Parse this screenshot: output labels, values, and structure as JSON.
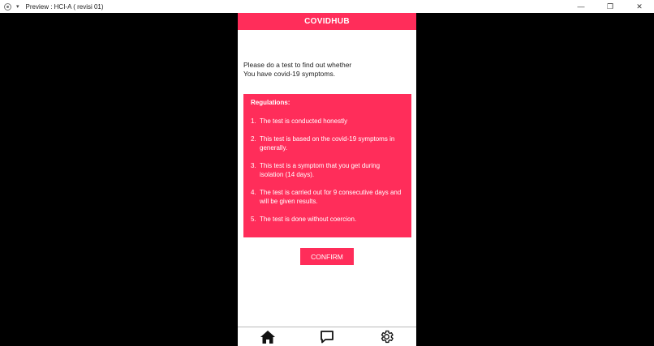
{
  "window": {
    "title": "Preview : HCI-A ( revisi 01)",
    "minimize_glyph": "—",
    "restore_glyph": "❐",
    "close_glyph": "✕"
  },
  "app": {
    "brand": "COVIDHUB",
    "accent": "#ff2d5a"
  },
  "intro": {
    "line1": "Please do a test to find out whether",
    "line2": "You have covid-19 symptoms."
  },
  "regulations": {
    "title": "Regulations:",
    "items": [
      {
        "num": "1.",
        "text": "The test is conducted honestly"
      },
      {
        "num": "2.",
        "text": "This test is based on the covid-19 symptoms in generally."
      },
      {
        "num": "3.",
        "text": "This test is a symptom that you get during isolation (14 days)."
      },
      {
        "num": "4.",
        "text": "The test is carried out for 9 consecutive days and will be given results."
      },
      {
        "num": "5.",
        "text": "The test is done without coercion."
      }
    ]
  },
  "confirm": {
    "label": "CONFIRM"
  },
  "nav": {
    "items": [
      {
        "icon": "home-icon"
      },
      {
        "icon": "chat-icon"
      },
      {
        "icon": "gear-icon"
      }
    ]
  }
}
